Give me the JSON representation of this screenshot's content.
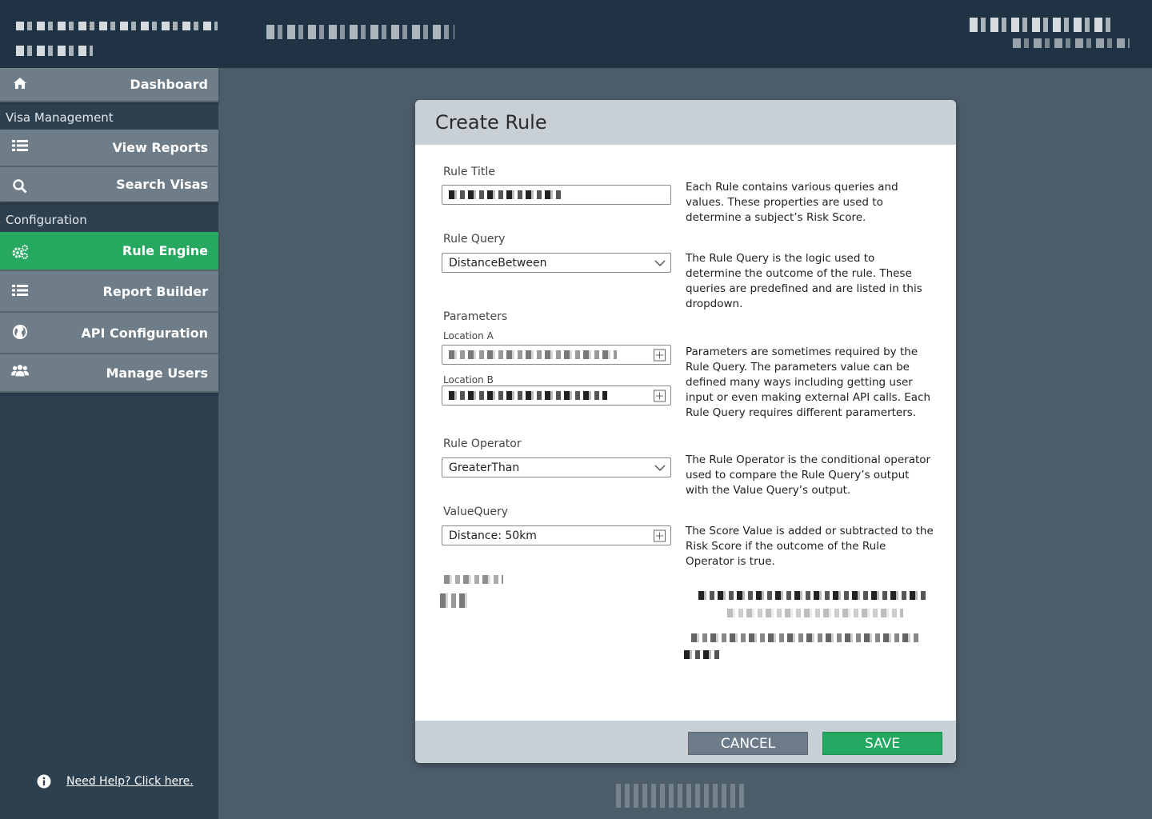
{
  "sidebar": {
    "dashboard": "Dashboard",
    "section_visa": "Visa Management",
    "view_reports": "View Reports",
    "search_visas": "Search Visas",
    "section_config": "Configuration",
    "rule_engine": "Rule Engine",
    "report_builder": "Report Builder",
    "api_configuration": "API Configuration",
    "manage_users": "Manage Users",
    "help_link": "Need Help? Click here."
  },
  "modal": {
    "title": "Create Rule",
    "rule_title_label": "Rule Title",
    "rule_title_desc": "Each Rule contains various queries and values. These properties are used to determine a subject’s Risk Score.",
    "rule_query_label": "Rule Query",
    "rule_query_value": "DistanceBetween",
    "rule_query_desc": "The Rule Query is the logic used to determine the outcome of the rule. These queries are predefined and are listed in this dropdown.",
    "parameters_label": "Parameters",
    "location_a_label": "Location A",
    "location_b_label": "Location B",
    "parameters_desc": "Parameters are sometimes required by the Rule Query. The parameters value can be defined many ways including getting user input or even making external API calls. Each Rule Query requires different paramerters.",
    "rule_operator_label": "Rule Operator",
    "rule_operator_value": "GreaterThan",
    "rule_operator_desc": "The Rule Operator is the conditional operator used to compare the Rule Query’s output with the Value Query’s output.",
    "value_query_label": "ValueQuery",
    "value_query_value": "Distance: 50km",
    "value_query_desc": "The Score Value is added or subtracted  to the Risk Score if the outcome of the Rule Operator is true.",
    "cancel_label": "CANCEL",
    "save_label": "SAVE"
  },
  "colors": {
    "topbar": "#1f3344",
    "sidebar": "#2d4050",
    "nav_item": "#6e7d88",
    "active": "#27a860",
    "save": "#23a862",
    "cancel": "#6d7c88",
    "modal_header": "#c8cfd5"
  },
  "icons": {
    "dashboard": "home-icon",
    "view_reports": "list-icon",
    "search_visas": "search-icon",
    "rule_engine": "gears-icon",
    "report_builder": "list-icon",
    "api_configuration": "globe-icon",
    "manage_users": "users-icon",
    "help": "info-icon"
  }
}
